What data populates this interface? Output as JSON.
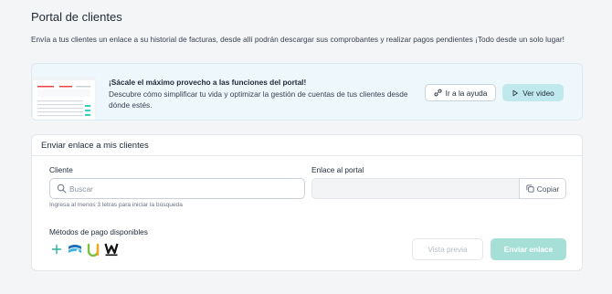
{
  "page": {
    "title": "Portal de clientes",
    "description": "Envía a tus clientes un enlace a su historial de facturas, desde allí podrán descargar sus comprobantes y realizar pagos pendientes ¡Todo desde un solo lugar!"
  },
  "promo": {
    "title": "¡Sácale el máximo provecho a las funciones del portal!",
    "text": "Descubre cómo simplificar tu vida y optimizar la gestión de cuentas de tus clientes desde dónde estés.",
    "help_label": "Ir a la ayuda",
    "video_label": "Ver video"
  },
  "card": {
    "title": "Enviar enlace a mis clientes",
    "client_label": "Cliente",
    "search_placeholder": "Buscar",
    "search_value": "",
    "search_hint": "Ingresa al menos 3 letras para iniciar la búsqueda",
    "portal_label": "Enlace al portal",
    "portal_value": "",
    "copy_label": "Copiar",
    "methods_label": "Métodos de pago disponibles",
    "preview_label": "Vista previa",
    "send_label": "Enviar enlace"
  },
  "colors": {
    "accent": "#a6dfd6",
    "video_button": "#bfe9ec",
    "promo_background": "#eef7fb"
  },
  "payment_methods": [
    "add-icon",
    "wallet-icon",
    "u-logo-icon",
    "w-logo-icon"
  ]
}
